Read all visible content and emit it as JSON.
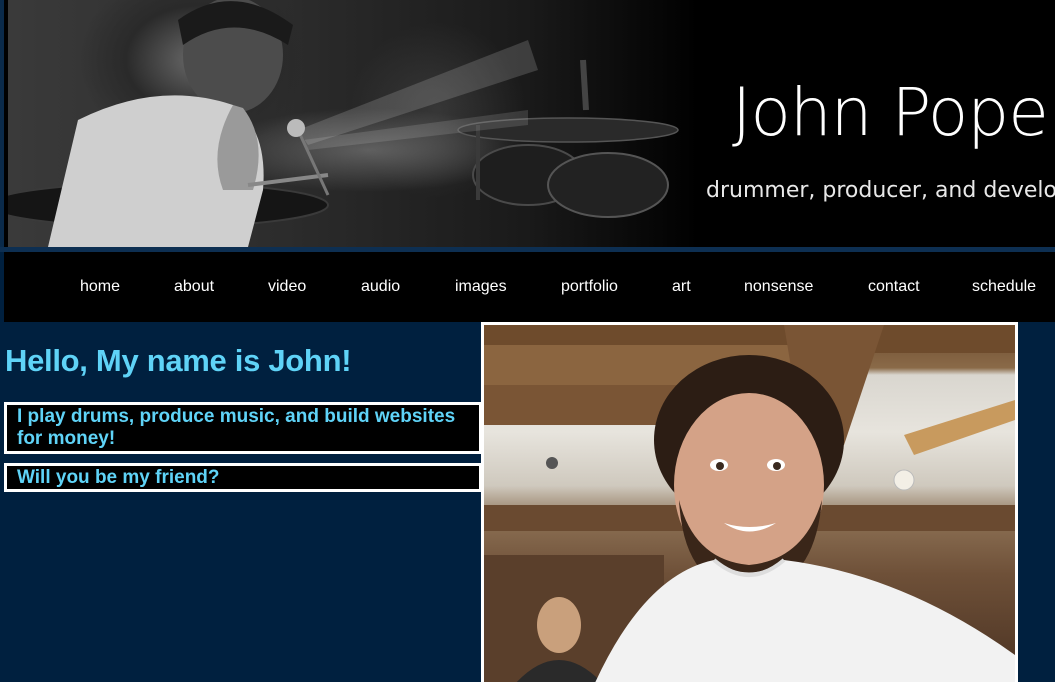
{
  "header": {
    "title": "John Pope",
    "tagline": "drummer, producer, and developer",
    "banner_photo": "drummer-on-stage-photo"
  },
  "nav": {
    "items": [
      {
        "label": "home"
      },
      {
        "label": "about"
      },
      {
        "label": "video"
      },
      {
        "label": "audio"
      },
      {
        "label": "images"
      },
      {
        "label": "portfolio"
      },
      {
        "label": "art"
      },
      {
        "label": "nonsense"
      },
      {
        "label": "contact"
      },
      {
        "label": "schedule"
      }
    ]
  },
  "main": {
    "greeting": "Hello, My name is John!",
    "callouts": [
      "I play drums, produce music, and build websites for money!",
      "Will you be my friend?"
    ],
    "portrait_photo": "smiling-portrait-photo"
  },
  "colors": {
    "page_background": "#00203f",
    "accent_text": "#5fd3f7",
    "nav_background": "#000000",
    "nav_text": "#ffffff"
  }
}
